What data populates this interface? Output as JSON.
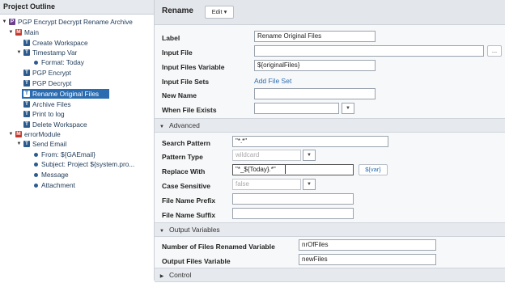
{
  "outline": {
    "title": "Project Outline",
    "nodes": [
      {
        "label": "PGP Encrypt Decrypt Rename Archive",
        "icon": "project-icon",
        "expand": "▼"
      },
      {
        "label": "Main",
        "icon": "module-icon",
        "expand": "▼"
      },
      {
        "label": "Create Workspace",
        "icon": "task-icon"
      },
      {
        "label": "Timestamp Var",
        "icon": "task-icon",
        "expand": "▼"
      },
      {
        "label": "Format: Today",
        "icon": "bullet"
      },
      {
        "label": "PGP Encrypt",
        "icon": "task-icon"
      },
      {
        "label": "PGP Decrypt",
        "icon": "task-icon"
      },
      {
        "label": "Rename Original Files",
        "icon": "task-icon",
        "selected": true
      },
      {
        "label": "Archive Files",
        "icon": "task-icon"
      },
      {
        "label": "Print to log",
        "icon": "task-icon"
      },
      {
        "label": "Delete Workspace",
        "icon": "task-icon"
      },
      {
        "label": "errorModule",
        "icon": "module-icon",
        "expand": "▼"
      },
      {
        "label": "Send Email",
        "icon": "task-icon",
        "expand": "▼"
      },
      {
        "label": "From: ${GAEmail}",
        "icon": "bullet"
      },
      {
        "label": "Subject: Project ${system.pro...",
        "icon": "bullet"
      },
      {
        "label": "Message",
        "icon": "bullet"
      },
      {
        "label": "Attachment",
        "icon": "bullet"
      }
    ]
  },
  "panel": {
    "title": "Rename",
    "edit_label": "Edit ▾",
    "fields": {
      "label": {
        "label": "Label",
        "value": "Rename Original Files"
      },
      "input_file": {
        "label": "Input File",
        "value": "",
        "browse": "..."
      },
      "input_files_variable": {
        "label": "Input Files Variable",
        "value": "${originalFiles}"
      },
      "input_file_sets": {
        "label": "Input File Sets",
        "link": "Add File Set"
      },
      "new_name": {
        "label": "New Name",
        "value": ""
      },
      "when_file_exists": {
        "label": "When File Exists",
        "value": ""
      }
    },
    "advanced": {
      "header": "Advanced",
      "search_pattern": {
        "label": "Search Pattern",
        "value": "\"*.*\""
      },
      "pattern_type": {
        "label": "Pattern Type",
        "value": "wildcard"
      },
      "replace_with": {
        "label": "Replace With",
        "value": "\"*_${Today}.*\"",
        "var_button": "${var}"
      },
      "case_sensitive": {
        "label": "Case Sensitive",
        "value": "false"
      },
      "file_name_prefix": {
        "label": "File Name Prefix",
        "value": ""
      },
      "file_name_suffix": {
        "label": "File Name Suffix",
        "value": ""
      }
    },
    "output_variables": {
      "header": "Output Variables",
      "files_renamed": {
        "label": "Number of Files Renamed Variable",
        "value": "nrOfFiles"
      },
      "output_files": {
        "label": "Output Files Variable",
        "value": "newFiles"
      }
    },
    "control": {
      "header": "Control"
    }
  },
  "colors": {
    "accent": "#2b6cb0",
    "module": "#c43a2f",
    "task": "#2c5c8f"
  }
}
